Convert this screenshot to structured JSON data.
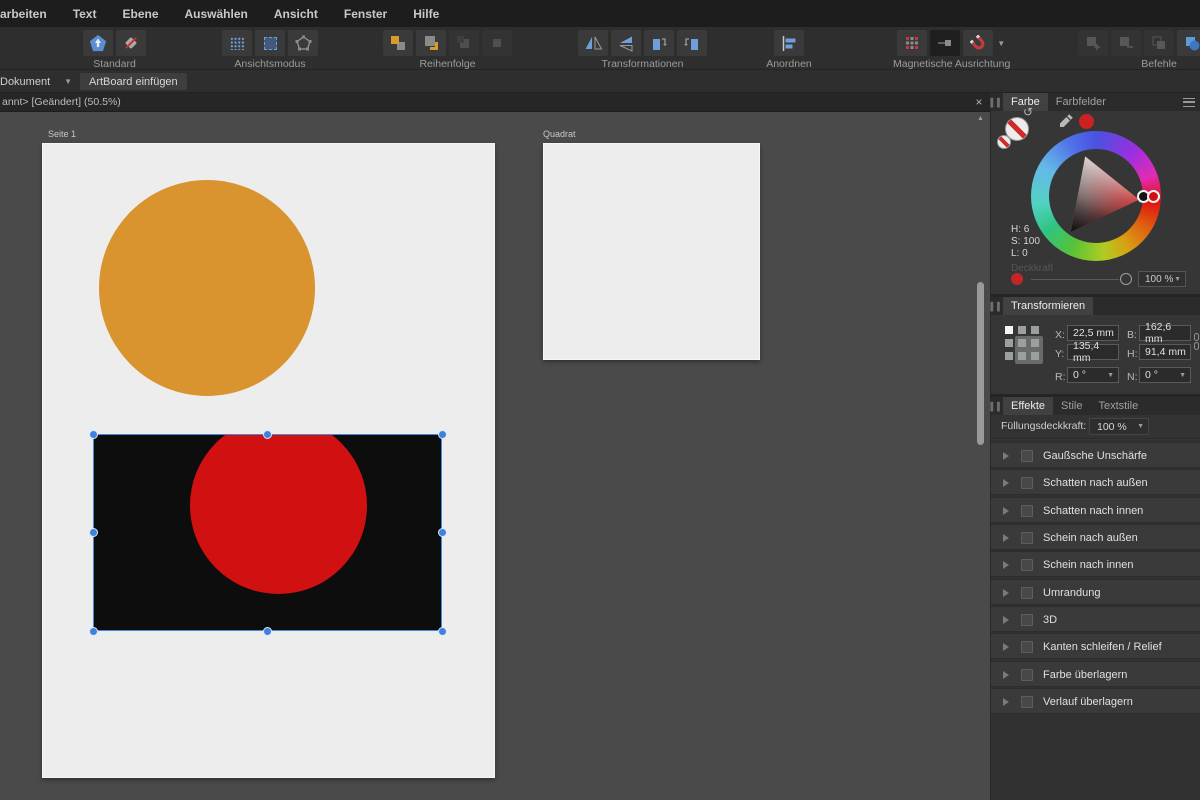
{
  "menubar": {
    "items": [
      "arbeiten",
      "Text",
      "Ebene",
      "Auswählen",
      "Ansicht",
      "Fenster",
      "Hilfe"
    ]
  },
  "toolbar": {
    "groups": {
      "standard": {
        "label": "Standard"
      },
      "ansichtsmodus": {
        "label": "Ansichtsmodus"
      },
      "reihenfolge": {
        "label": "Reihenfolge"
      },
      "transformationen": {
        "label": "Transformationen"
      },
      "anordnen": {
        "label": "Anordnen"
      },
      "magnetische_ausrichtung": {
        "label": "Magnetische Ausrichtung"
      },
      "befehle": {
        "label": "Befehle"
      }
    }
  },
  "contextbar": {
    "document_dropdown": "Dokument",
    "insert_artboard_button": "ArtBoard einfügen"
  },
  "document_tab": {
    "title": "annt> [Geändert] (50.5%)",
    "zoom_level": "50.5%",
    "close_icon": "×"
  },
  "canvas": {
    "artboards": [
      {
        "name": "Seite 1"
      },
      {
        "name": "Quadrat"
      }
    ]
  },
  "colors": {
    "orange_circle": "#d9932f",
    "black_rectangle": "#0d0d0d",
    "red_circle": "#d11111",
    "selection_accent": "#4a87d8",
    "swatch_red": "#cc2222"
  },
  "color_panel": {
    "tabs": [
      "Farbe",
      "Farbfelder"
    ],
    "active_tab": "Farbe",
    "hsl": {
      "h_label": "H: 6",
      "s_label": "S: 100",
      "l_label": "L: 0"
    },
    "opacity_label": "Deckkraft",
    "opacity_value": "100 %"
  },
  "transform_panel": {
    "title": "Transformieren",
    "fields": {
      "x_label": "X:",
      "x_value": "22,5 mm",
      "y_label": "Y:",
      "y_value": "135,4 mm",
      "r_label": "R:",
      "r_value": "0 °",
      "b_label": "B:",
      "b_value": "162,6 mm",
      "h_label": "H:",
      "h_value": "91,4 mm",
      "n_label": "N:",
      "n_value": "0 °"
    }
  },
  "effects_panel": {
    "tabs": [
      "Effekte",
      "Stile",
      "Textstile"
    ],
    "active_tab": "Effekte",
    "fill_opacity_label": "Füllungsdeckkraft:",
    "fill_opacity_value": "100 %",
    "effects": [
      "Gaußsche Unschärfe",
      "Schatten nach außen",
      "Schatten nach innen",
      "Schein nach außen",
      "Schein nach innen",
      "Umrandung",
      "3D",
      "Kanten schleifen / Relief",
      "Farbe überlagern",
      "Verlauf überlagern"
    ]
  }
}
